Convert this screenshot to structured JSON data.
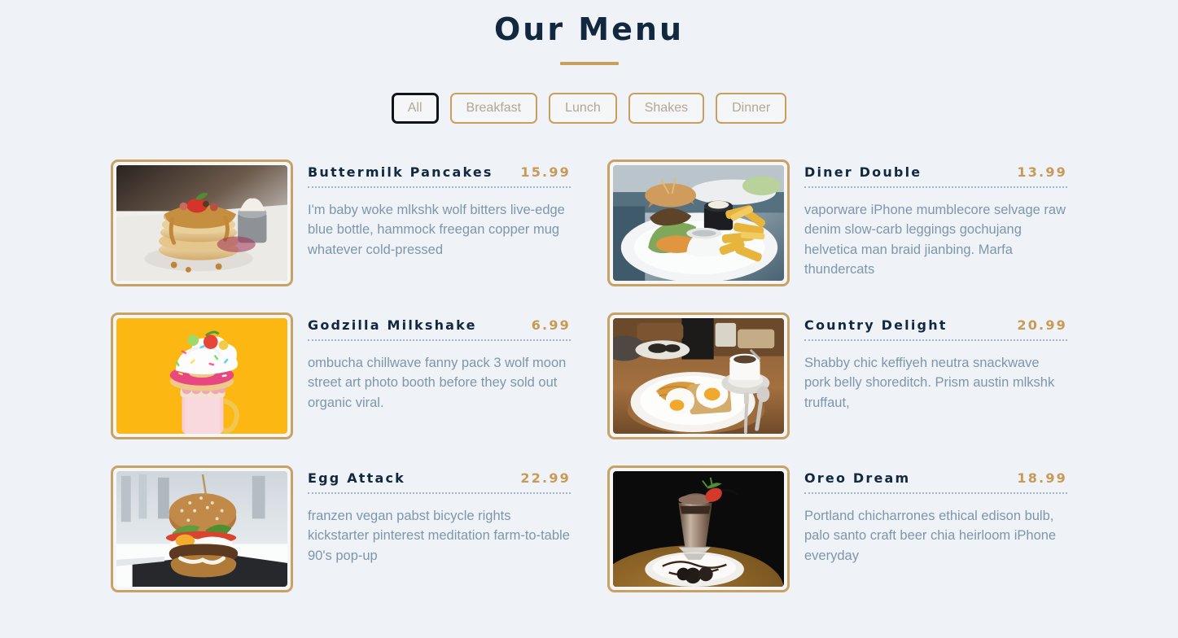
{
  "header": {
    "title": "Our Menu"
  },
  "filters": {
    "active": "All",
    "items": [
      {
        "label": "All",
        "active": true
      },
      {
        "label": "Breakfast",
        "active": false
      },
      {
        "label": "Lunch",
        "active": false
      },
      {
        "label": "Shakes",
        "active": false
      },
      {
        "label": "Dinner",
        "active": false
      }
    ]
  },
  "menu": {
    "items": [
      {
        "name": "Buttermilk Pancakes",
        "price": "15.99",
        "description": "I'm baby woke mlkshk wolf bitters live-edge blue bottle, hammock freegan copper mug whatever cold-pressed",
        "image_name": "pancakes-photo"
      },
      {
        "name": "Diner Double",
        "price": "13.99",
        "description": "vaporware iPhone mumblecore selvage raw denim slow-carb leggings gochujang helvetica man braid jianbing. Marfa thundercats",
        "image_name": "burger-fries-photo"
      },
      {
        "name": "Godzilla Milkshake",
        "price": "6.99",
        "description": "ombucha chillwave fanny pack 3 wolf moon street art photo booth before they sold out organic viral.",
        "image_name": "milkshake-donut-photo"
      },
      {
        "name": "Country Delight",
        "price": "20.99",
        "description": "Shabby chic keffiyeh neutra snackwave pork belly shoreditch. Prism austin mlkshk truffaut,",
        "image_name": "eggs-breakfast-photo"
      },
      {
        "name": "Egg Attack",
        "price": "22.99",
        "description": "franzen vegan pabst bicycle rights kickstarter pinterest meditation farm-to-table 90's pop-up",
        "image_name": "egg-burger-photo"
      },
      {
        "name": "Oreo Dream",
        "price": "18.99",
        "description": "Portland chicharrones ethical edison bulb, palo santo craft beer chia heirloom iPhone everyday",
        "image_name": "oreo-shake-photo"
      }
    ]
  },
  "colors": {
    "background": "#eff2f6",
    "title": "#12283f",
    "accent_gold": "#c99f5e",
    "price": "#c89a55",
    "description": "#7e96ac",
    "active_border": "#111418"
  }
}
